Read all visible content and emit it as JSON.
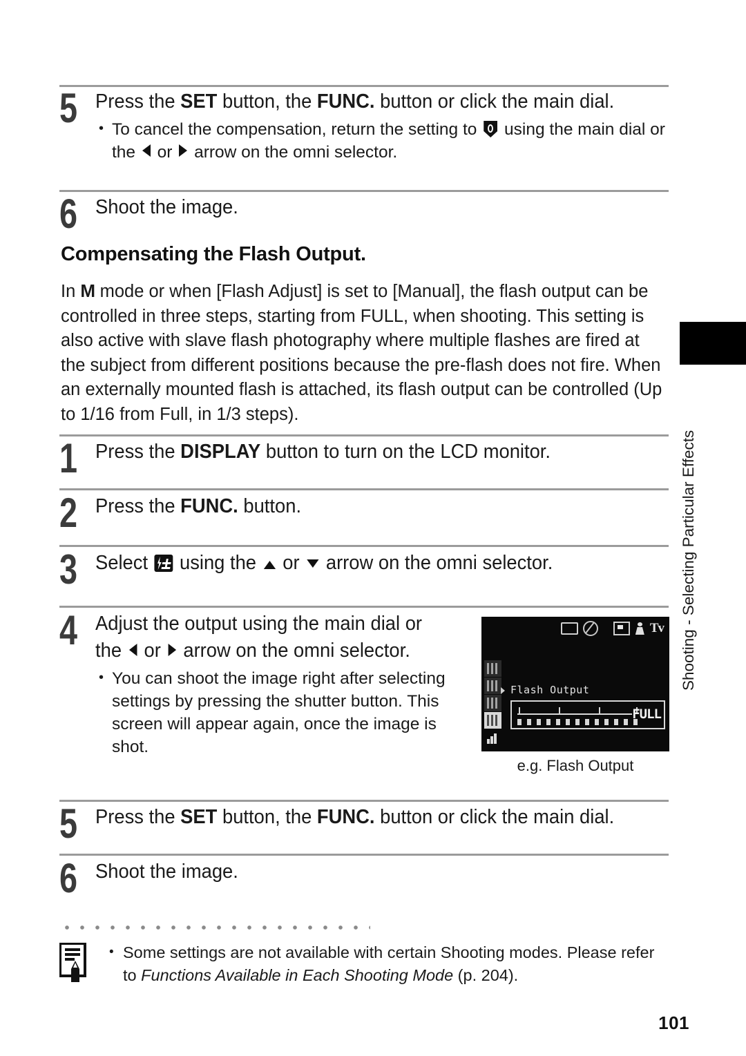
{
  "page": {
    "number": "101",
    "side_tab_title": "Shooting - Selecting Particular Effects"
  },
  "top_steps": [
    {
      "num": "5",
      "title_parts": [
        "Press the ",
        "SET",
        " button, the ",
        "FUNC.",
        " button or click the main dial."
      ],
      "bullets": [
        "To cancel the compensation, return the setting to ⬤ using the main dial or the ◀ or ▶ arrow on the omni selector."
      ],
      "bullet_lead": "To cancel the compensation, return the setting to ",
      "bullet_mid": " using the main dial or",
      "bullet_line2_a": "the ",
      "bullet_line2_b": " or ",
      "bullet_line2_c": " arrow on the omni selector."
    },
    {
      "num": "6",
      "title": "Shoot the image."
    }
  ],
  "section": {
    "heading": "Compensating the Flash Output.",
    "intro_a": "In ",
    "intro_mode": "M",
    "intro_b": " mode or when [Flash Adjust] is set to [Manual], the flash output can be controlled in three steps, starting from FULL, when shooting. This setting is also active with slave flash photography where multiple flashes are fired at the subject from different positions because the pre-flash does not fire. When an externally mounted flash is attached, its flash output can be controlled (Up to 1/16 from Full, in 1/3 steps)."
  },
  "procedure": {
    "step1": {
      "num": "1",
      "a": "Press the ",
      "bold": "DISPLAY",
      "b": " button to turn on the LCD monitor."
    },
    "step2": {
      "num": "2",
      "a": "Press the ",
      "bold": "FUNC.",
      "b": " button."
    },
    "step3": {
      "num": "3",
      "a": "Select ",
      "b": " using the ",
      "c": " or ",
      "d": " arrow on the omni selector."
    },
    "step4": {
      "num": "4",
      "line1": "Adjust the output using the main dial or",
      "line2_a": "the ",
      "line2_b": " or ",
      "line2_c": " arrow on the omni selector.",
      "bullet": "You can shoot the image right after selecting settings by pressing the shutter button. This screen will appear again, once the image is shot."
    },
    "step5": {
      "num": "5",
      "a": "Press the ",
      "bold1": "SET",
      "b": " button, the ",
      "bold2": "FUNC.",
      "c": " button or click the main dial."
    },
    "step6": {
      "num": "6",
      "title": "Shoot the image."
    }
  },
  "lcd": {
    "caption": "e.g. Flash Output",
    "label": "Flash Output",
    "value": "FULL",
    "top_icons": [
      "single-shot-icon",
      "no-flash-icon",
      "metering-icon",
      "self-timer-icon",
      "Tv"
    ],
    "tv_label": "Tv",
    "side_icon_count": 5,
    "selected_side_index": 3
  },
  "footnote": {
    "icon": "note-pencil-icon",
    "text_a": "Some settings are not available with certain Shooting modes. Please refer to ",
    "text_italic": "Functions Available in Each Shooting Mode",
    "text_b": " (p. 204)."
  },
  "colors": {
    "rule": "#9b9b9b",
    "step_number": "#3b3b3b",
    "highlight": "#c9c9c9",
    "tab": "#000000",
    "lcd_background": "#0a0a0a",
    "lcd_foreground": "#e2e2e2"
  }
}
